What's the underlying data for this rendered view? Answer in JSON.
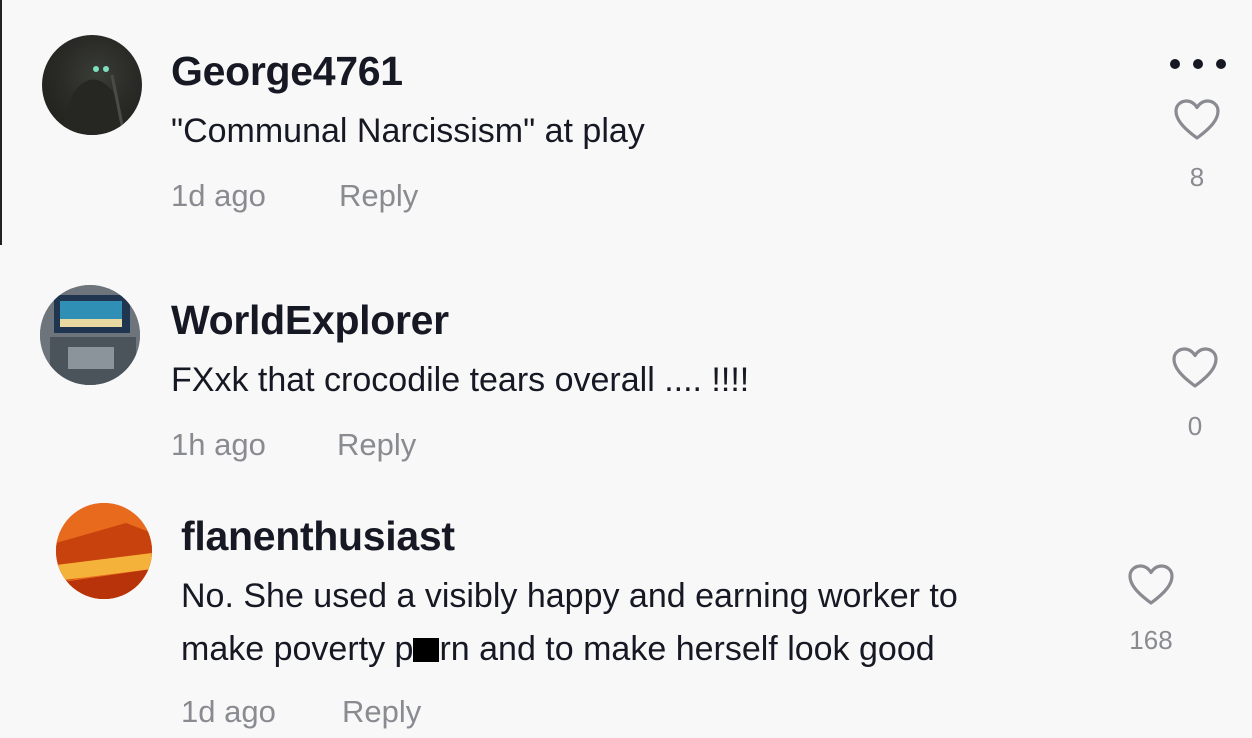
{
  "comments": [
    {
      "username": "George4761",
      "text": "\"Communal Narcissism\" at play",
      "time": "1d ago",
      "reply_label": "Reply",
      "likes": "8",
      "avatar_icon": "dark-cave-avatar"
    },
    {
      "username": "WorldExplorer",
      "text": "FXxk that crocodile tears overall .... !!!!",
      "time": "1h ago",
      "reply_label": "Reply",
      "likes": "0",
      "avatar_icon": "screen-photo-avatar"
    },
    {
      "username": "flanenthusiast",
      "text_line1": "No. She used a visibly happy and earning worker to",
      "text_line2_before": "make poverty p",
      "text_line2_after": "rn and to make herself look good",
      "time": "1d ago",
      "reply_label": "Reply",
      "likes": "168",
      "avatar_icon": "orange-flan-avatar"
    }
  ],
  "icons": {
    "more": "more-options-icon",
    "like": "heart-icon"
  },
  "colors": {
    "background": "#f8f8f8",
    "text_primary": "#161823",
    "text_secondary": "#8a8b91"
  }
}
